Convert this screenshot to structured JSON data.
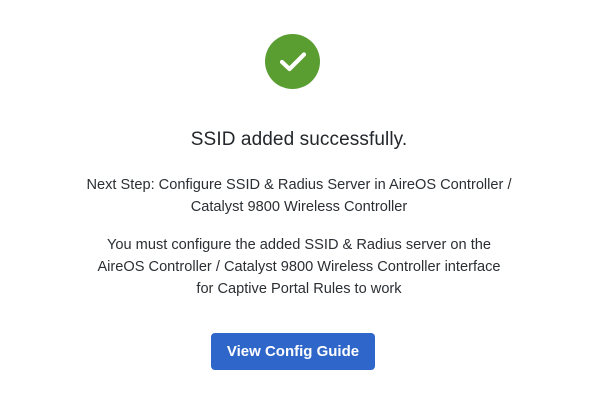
{
  "status": {
    "icon": "check-circle-icon",
    "color": "#5a9e32"
  },
  "title": "SSID added successfully.",
  "next_step": {
    "line1": "Next Step: Configure SSID & Radius Server in AireOS Controller /",
    "line2": "Catalyst 9800 Wireless Controller"
  },
  "instructions": {
    "line1": "You must configure the added SSID & Radius server on the",
    "line2": "AireOS Controller / Catalyst 9800 Wireless Controller interface",
    "line3": "for Captive Portal Rules to work"
  },
  "button": {
    "label": "View Config Guide",
    "color": "#2f66c9"
  }
}
